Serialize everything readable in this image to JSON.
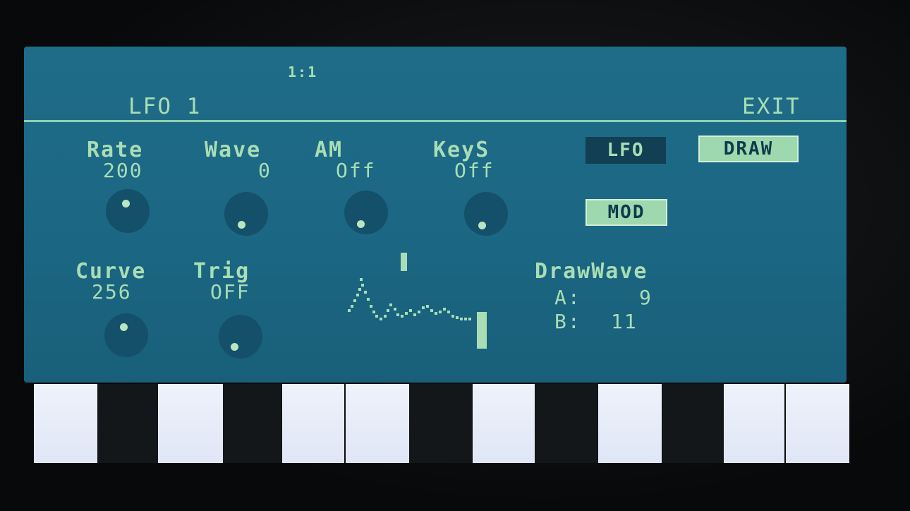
{
  "header": {
    "title": "LFO 1",
    "page_indicator": "1:1",
    "exit_label": "EXIT"
  },
  "row1_params": [
    {
      "label": "Rate",
      "value": "200"
    },
    {
      "label": "Wave",
      "value": "0"
    },
    {
      "label": "AM",
      "value": "Off"
    },
    {
      "label": "KeyS",
      "value": "Off"
    }
  ],
  "row2_params": [
    {
      "label": "Curve",
      "value": "256"
    },
    {
      "label": "Trig",
      "value": "OFF"
    }
  ],
  "mode_buttons": {
    "lfo": "LFO",
    "draw": "DRAW",
    "mod": "MOD"
  },
  "drawwave": {
    "title": "DrawWave",
    "a_label": "A:",
    "a_value": "9",
    "b_label": "B:",
    "b_value": "11"
  },
  "colors": {
    "lcd_background": "#1d6a87",
    "lcd_text": "#a9ddb4",
    "button_dark": "#123f54",
    "button_light": "#9ed8ae"
  }
}
